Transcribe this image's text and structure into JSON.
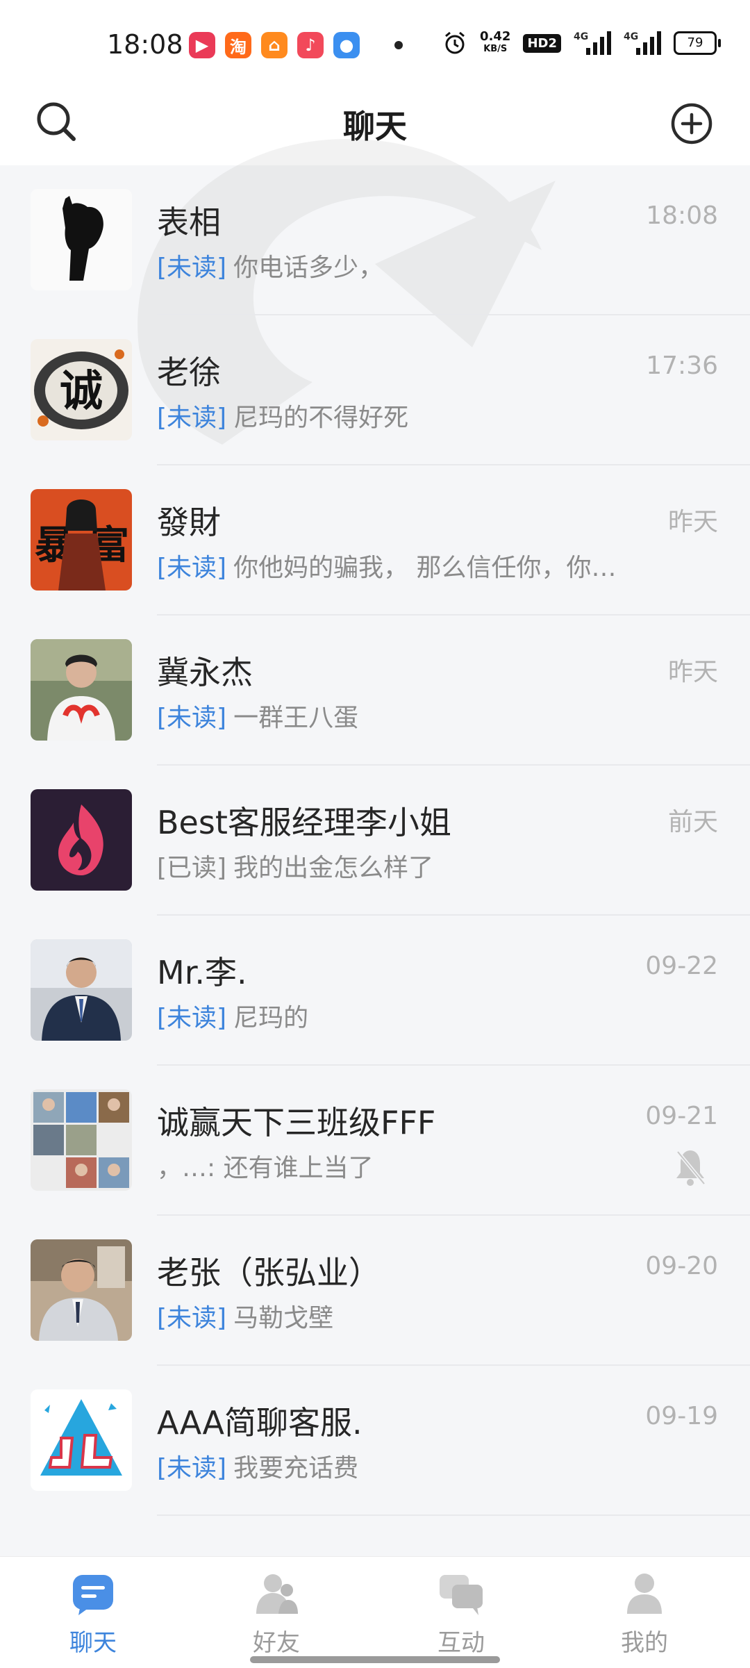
{
  "status_bar": {
    "time": "18:08",
    "rate_value": "0.42",
    "rate_unit": "KB/S",
    "hd": "HD2",
    "sim1": "4G",
    "sim2": "4G",
    "battery": "79",
    "app_icons": [
      {
        "name": "video-app-icon",
        "glyph": "▶",
        "color": "#ea3a57"
      },
      {
        "name": "taobao-app-icon",
        "glyph": "淘",
        "color": "#ff6a1a"
      },
      {
        "name": "home-app-icon",
        "glyph": "⌂",
        "color": "#ff8a1e"
      },
      {
        "name": "music-app-icon",
        "glyph": "♪",
        "color": "#f2495a"
      },
      {
        "name": "circle-app-icon",
        "glyph": "●",
        "color": "#3b8ff0"
      }
    ]
  },
  "header": {
    "title": "聊天"
  },
  "chats": [
    {
      "name": "表相",
      "time": "18:08",
      "status": "[未读]",
      "status_type": "unread",
      "message": "你电话多少，",
      "avatar": "silhouette",
      "muted": false
    },
    {
      "name": "老徐",
      "time": "17:36",
      "status": "[未读]",
      "status_type": "unread",
      "message": "尼玛的不得好死",
      "avatar": "cheng",
      "muted": false
    },
    {
      "name": "發財",
      "time": "昨天",
      "status": "[未读]",
      "status_type": "unread",
      "message": "你他妈的骗我， 那么信任你，你…",
      "avatar": "baofu",
      "muted": false
    },
    {
      "name": "冀永杰",
      "time": "昨天",
      "status": "[未读]",
      "status_type": "unread",
      "message": "一群王八蛋",
      "avatar": "person-white-shirt",
      "muted": false
    },
    {
      "name": "Best客服经理李小姐",
      "time": "前天",
      "status": "[已读]",
      "status_type": "read",
      "message": "我的出金怎么样了",
      "avatar": "flame-logo",
      "muted": false
    },
    {
      "name": "Mr.李.",
      "time": "09-22",
      "status": "[未读]",
      "status_type": "unread",
      "message": "尼玛的",
      "avatar": "person-suit",
      "muted": false
    },
    {
      "name": "诚赢天下三班级FFF",
      "time": "09-21",
      "status": "",
      "status_type": "none",
      "message": "，…: 还有谁上当了",
      "avatar": "group-grid",
      "muted": true
    },
    {
      "name": "老张（张弘业）",
      "time": "09-20",
      "status": "[未读]",
      "status_type": "unread",
      "message": "马勒戈壁",
      "avatar": "person-car",
      "muted": false
    },
    {
      "name": "AAA简聊客服.",
      "time": "09-19",
      "status": "[未读]",
      "status_type": "unread",
      "message": "我要充话费",
      "avatar": "jl-logo",
      "muted": false
    }
  ],
  "nav": [
    {
      "label": "聊天",
      "active": true
    },
    {
      "label": "好友",
      "active": false
    },
    {
      "label": "互动",
      "active": false
    },
    {
      "label": "我的",
      "active": false
    }
  ],
  "colors": {
    "accent": "#3d84dc",
    "background": "#f5f6f8",
    "time_gray": "#b2b2b2"
  }
}
